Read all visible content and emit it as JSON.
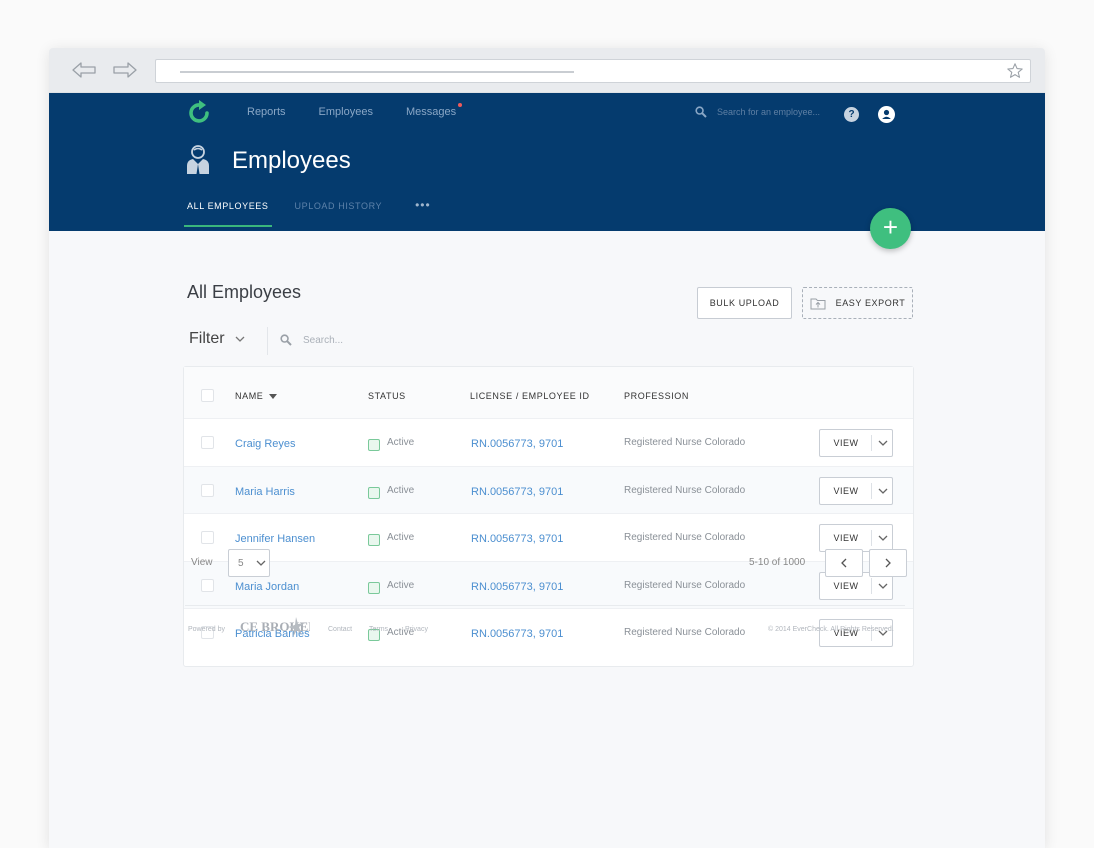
{
  "header": {
    "nav": [
      "Reports",
      "Employees",
      "Messages"
    ],
    "search_placeholder": "Search for an employee...",
    "help_label": "?",
    "page_title": "Employees",
    "tabs": [
      "ALL EMPLOYEES",
      "UPLOAD HISTORY",
      "•••"
    ],
    "fab_label": "+"
  },
  "main": {
    "title": "All Employees",
    "bulk_upload": "BULK UPLOAD",
    "easy_export": "EASY EXPORT",
    "filter_label": "Filter",
    "search_placeholder": "Search...",
    "columns": [
      "NAME",
      "STATUS",
      "LICENSE / EMPLOYEE ID",
      "PROFESSION"
    ],
    "rows": [
      {
        "name": "Craig Reyes",
        "status": "Active",
        "license": "RN.0056773, 9701",
        "profession": "Registered Nurse Colorado",
        "action": "VIEW"
      },
      {
        "name": "Maria Harris",
        "status": "Active",
        "license": "RN.0056773, 9701",
        "profession": "Registered Nurse Colorado",
        "action": "VIEW"
      },
      {
        "name": "Jennifer Hansen",
        "status": "Active",
        "license": "RN.0056773, 9701",
        "profession": "Registered Nurse Colorado",
        "action": "VIEW"
      },
      {
        "name": "Maria Jordan",
        "status": "Active",
        "license": "RN.0056773, 9701",
        "profession": "Registered Nurse Colorado",
        "action": "VIEW"
      },
      {
        "name": "Patricia Barnes",
        "status": "Active",
        "license": "RN.0056773, 9701",
        "profession": "Registered Nurse Colorado",
        "action": "VIEW"
      }
    ],
    "pagination": {
      "view_label": "View",
      "per_page": "5",
      "range": "5-10 of 1000"
    }
  },
  "footer": {
    "powered_by": "Powered by",
    "brand": "CE BROKER",
    "links": [
      "Contact",
      "Terms",
      "Privacy"
    ],
    "copyright": "© 2014 EverCheck. All Rights Reserved."
  },
  "colors": {
    "header_bg": "#053b6e",
    "accent_green": "#3fbf7f",
    "link_blue": "#4c8fd0"
  }
}
